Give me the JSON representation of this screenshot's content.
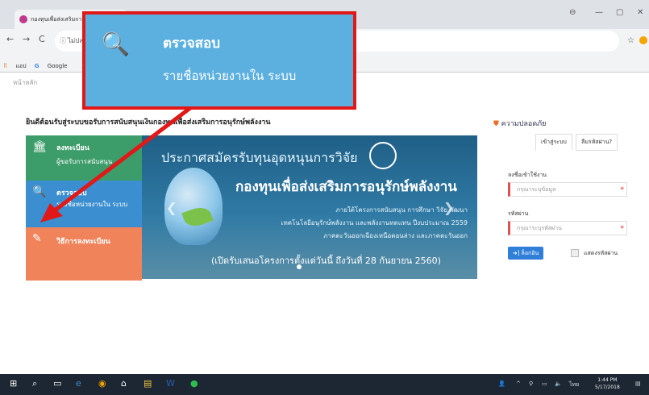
{
  "browser": {
    "tab_title": "กองทุนเพื่อส่งเสริมการ",
    "url_prefix": "ไม่ปล",
    "bookmarks": [
      "แอป",
      "Google"
    ],
    "window_controls": [
      "⊖",
      "—",
      "▢",
      "✕"
    ]
  },
  "page": {
    "breadcrumb": "หน้าหลัก",
    "welcome": "ยินดีต้อนรับสู่ระบบขอรับการสนับสนุนเงินกองทุนเพื่อส่งเสริมการอนุรักษ์พลังงาน",
    "menu": [
      {
        "icon": "bank-icon",
        "title": "ลงทะเบียน",
        "sub": "ผู้ขอรับการสนับสนุน",
        "color": "#3c9c6a"
      },
      {
        "icon": "search-icon",
        "title": "ตรวจสอบ",
        "sub": "รายชื่อหน่วยงานใน ระบบ",
        "color": "#3b8fd0"
      },
      {
        "icon": "edit-icon",
        "title": "วิธีการลงทะเบียน",
        "sub": "",
        "color": "#f0835a"
      }
    ],
    "banner": {
      "title": "ประกาศสมัครรับทุนอุดหนุนการวิจัย",
      "heading": "กองทุนเพื่อส่งเสริมการอนุรักษ์พลังงาน",
      "line1": "ภายใต้โครงการสนับสนุน การศึกษา วิจัย พัฒนา",
      "line2": "เทคโนโลยีอนุรักษ์พลังงาน และพลังงานทดแทน ปีงบประมาณ 2559",
      "line3": "ภาคตะวันออกเฉียงเหนือตอนล่าง และภาคตะวันออก",
      "deadline": "(เปิดรับเสนอโครงการตั้งแต่วันนี้ ถึงวันที่ 28 กันยายน 2560)"
    }
  },
  "login": {
    "title": "ความปลอดภัย",
    "tabs": [
      "เข้าสู่ระบบ",
      "ลืมรหัสผ่าน?"
    ],
    "username_label": "ลงชื่อเข้าใช้งาน",
    "username_placeholder": "กรุณาระบุข้อมูล",
    "password_label": "รหัสผ่าน",
    "password_placeholder": "กรุณาระบุรหัสผ่าน",
    "login_button": "ล็อกอิน",
    "show_password": "แสดงรหัสผ่าน"
  },
  "callout": {
    "title": "ตรวจสอบ",
    "subtitle": "รายชื่อหน่วยงานใน ระบบ",
    "border_color": "#e01818",
    "bg_color": "#5bb0e0"
  },
  "taskbar": {
    "time": "1:44 PM",
    "date": "5/17/2018",
    "lang": "ไทย"
  }
}
